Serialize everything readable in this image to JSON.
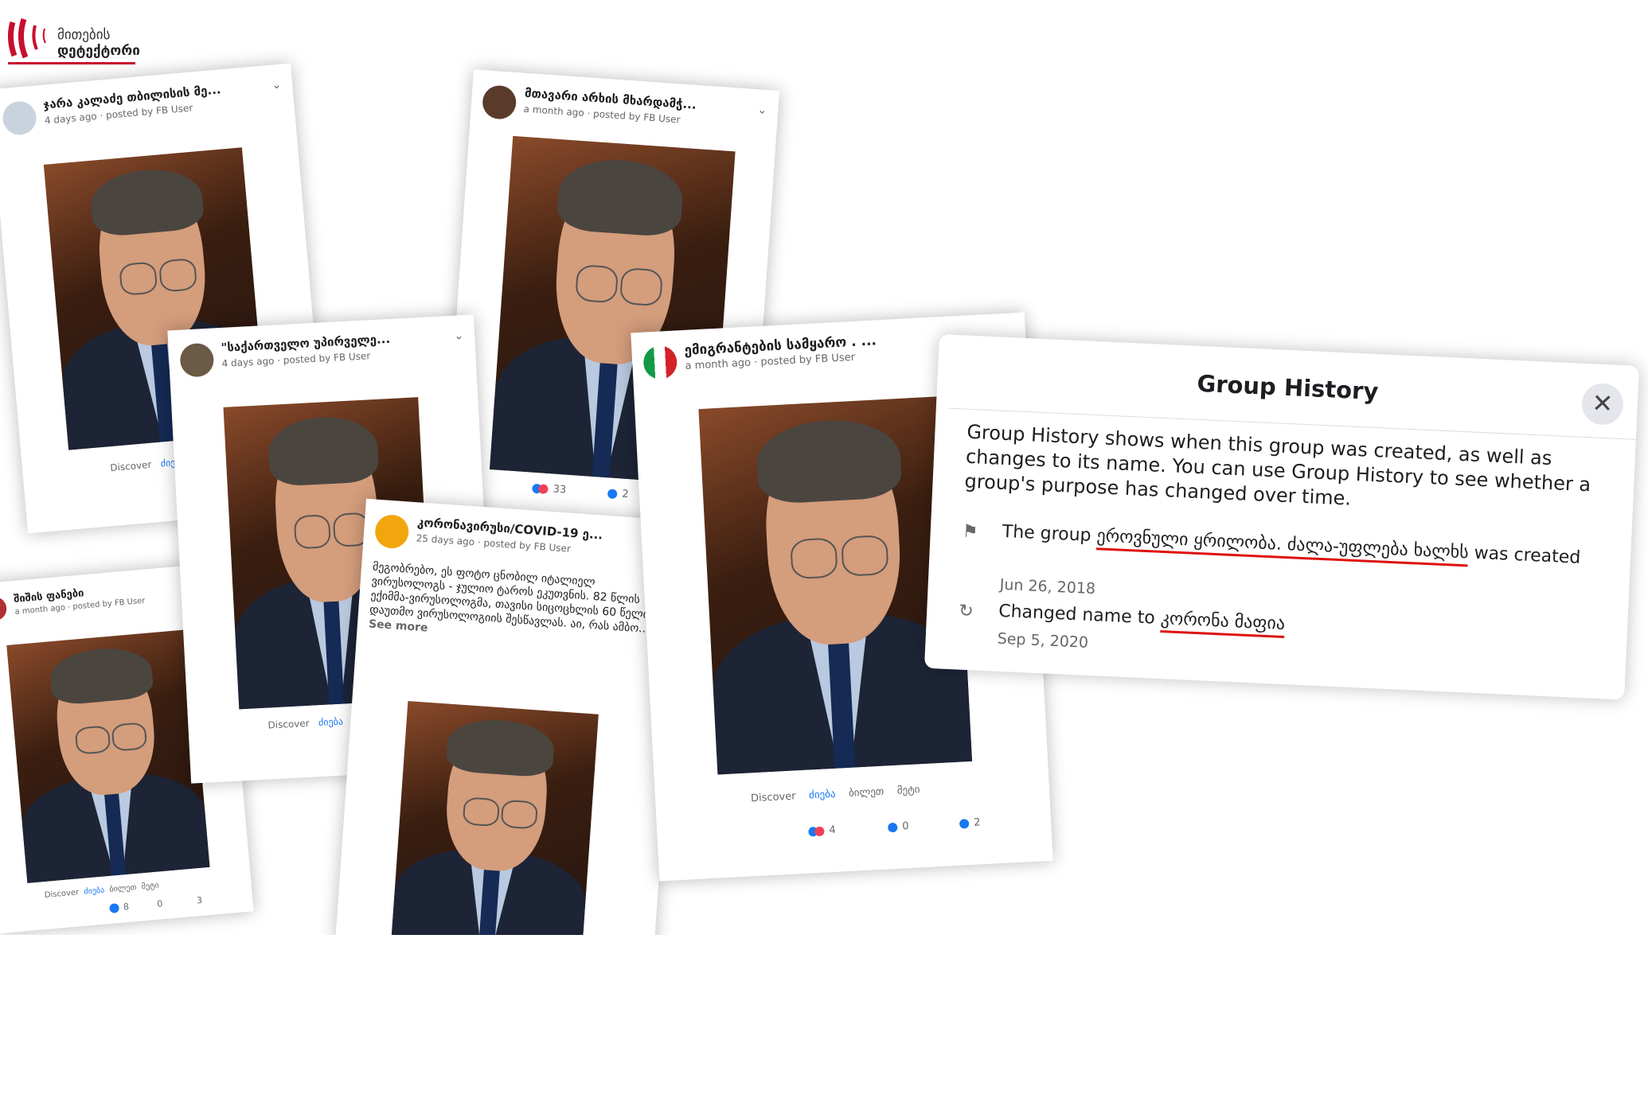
{
  "logo": {
    "line1": "მითების",
    "line2": "დეტექტორი"
  },
  "cards": [
    {
      "id": "c1",
      "group": "ჯარა კალაძე თბილისის მე...",
      "meta": "4 days ago · posted by FB User",
      "nav": [
        "Discover",
        "ძიება"
      ],
      "counts": [
        "",
        "0"
      ]
    },
    {
      "id": "c2",
      "group": "მთავარი არხის მხარდამჭ...",
      "meta": "a month ago · posted by FB User",
      "nav": [],
      "counts": [
        "33",
        "2"
      ]
    },
    {
      "id": "c3",
      "group": "\"საქართველო უპირველე...",
      "meta": "4 days ago · posted by FB User",
      "nav": [
        "Discover",
        "ძიება"
      ],
      "counts": [
        "",
        ""
      ]
    },
    {
      "id": "c4",
      "group": "ემიგრანტების სამყარო . ...",
      "meta": "a month ago · posted by FB User",
      "nav": [
        "Discover",
        "ძიება",
        "ბილეთ",
        "მეტი"
      ],
      "counts": [
        "4",
        "0",
        "2"
      ]
    },
    {
      "id": "c5",
      "group": "შიშის ფანები",
      "meta": "a month ago · posted by FB User",
      "nav": [
        "Discover",
        "ძიება",
        "ბილეთ",
        "მეტი"
      ],
      "counts": [
        "8",
        "0",
        "3"
      ]
    },
    {
      "id": "c6",
      "group": "კორონავირუსი/COVID-19 ე...",
      "meta": "25 days ago · posted by FB User",
      "body": "მეგობრებო, ეს ფოტო ცნობილ იტალიელ ვირუსოლოგს - ჯულიო ტაროს ეკუთვნის. 82 წლის ექიმმა-ვირუსოლოგმა, თავისი სიცოცხლის 60 წელი დაუთმო ვირუსოლოგიის შესწავლას. აი, რას ამბო...",
      "see_more": "See more"
    }
  ],
  "group_history": {
    "title": "Group History",
    "description": "Group History shows when this group was created, as well as changes to its name. You can use Group History to see whether a group's purpose has changed over time.",
    "created_prefix": "The group",
    "created_name": "ეროვნული ყრილობა. ძალა-უფლება ხალხს",
    "created_suffix": "was created",
    "created_date": "Jun 26, 2018",
    "changed_prefix": "Changed name to",
    "changed_name": "კორონა მაფია",
    "changed_date": "Sep 5, 2020",
    "close_label": "✕"
  },
  "colors": {
    "accent": "#1877f2",
    "underline": "#dd1111",
    "logo_red": "#c8102e"
  }
}
